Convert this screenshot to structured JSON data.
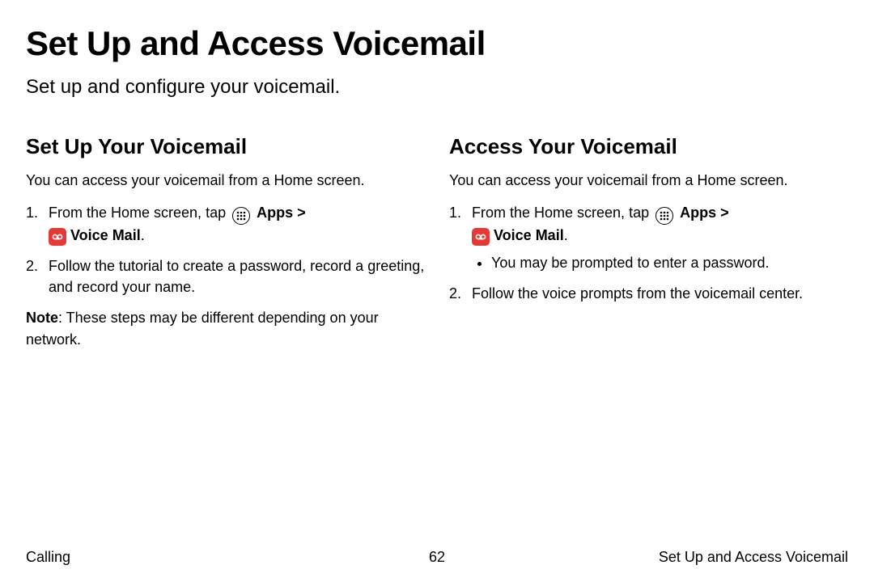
{
  "page": {
    "title": "Set Up and Access Voicemail",
    "subtitle": "Set up and configure your voicemail."
  },
  "icons": {
    "apps": "apps-icon",
    "voicemail": "voicemail-icon"
  },
  "left": {
    "heading": "Set Up Your Voicemail",
    "intro": "You can access your voicemail from a Home screen.",
    "step1_pre": "From the Home screen, tap ",
    "step1_apps": "Apps",
    "step1_sep": " > ",
    "step1_vm": "Voice Mail",
    "step1_post": ".",
    "step2": "Follow the tutorial to create a password, record a greeting, and record your name.",
    "note_label": "Note",
    "note_body": ": These steps may be different depending on your network."
  },
  "right": {
    "heading": "Access Your Voicemail",
    "intro": "You can access your voicemail from a Home screen.",
    "step1_pre": "From the Home screen, tap ",
    "step1_apps": "Apps",
    "step1_sep": " > ",
    "step1_vm": "Voice Mail",
    "step1_post": ".",
    "sub1": "You may be prompted to enter a password.",
    "step2": "Follow the voice prompts from the voicemail center."
  },
  "footer": {
    "left": "Calling",
    "center": "62",
    "right": "Set Up and Access Voicemail"
  }
}
